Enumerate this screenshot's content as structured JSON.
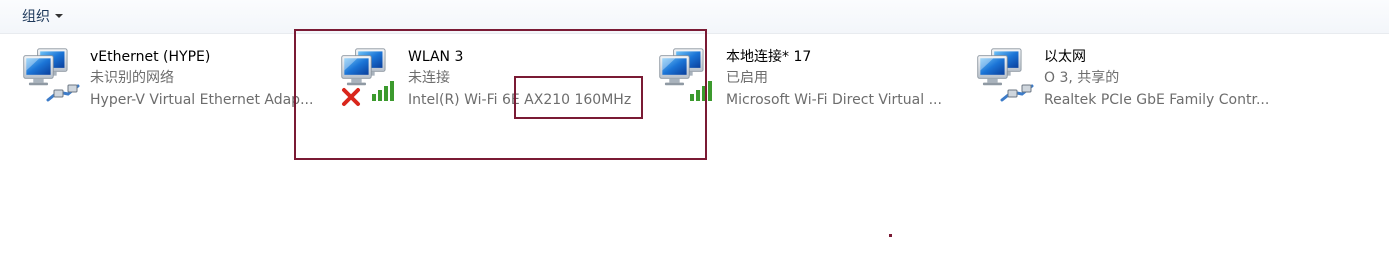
{
  "toolbar": {
    "organize_label": "组织"
  },
  "adapters": [
    {
      "name": "vEthernet (HYPE)",
      "status": "未识别的网络",
      "device": "Hyper-V Virtual Ethernet Adap...",
      "overlay": "ethernet-cable-icon"
    },
    {
      "name": "WLAN 3",
      "status": "未连接",
      "device": "Intel(R) Wi-Fi 6E AX210 160MHz",
      "overlay": "wifi-signal-disconnected-icon"
    },
    {
      "name": "本地连接* 17",
      "status": "已启用",
      "device": "Microsoft Wi-Fi Direct Virtual ...",
      "overlay": "wifi-signal-icon"
    },
    {
      "name": "以太网",
      "status": "O 3, 共享的",
      "device": "Realtek PCIe GbE Family Contr...",
      "overlay": "ethernet-cable-icon"
    }
  ],
  "colors": {
    "highlight": "#7a1a34",
    "status_text": "#6d6d6d",
    "signal_green": "#3c9a2e",
    "error_red": "#d9261c"
  }
}
